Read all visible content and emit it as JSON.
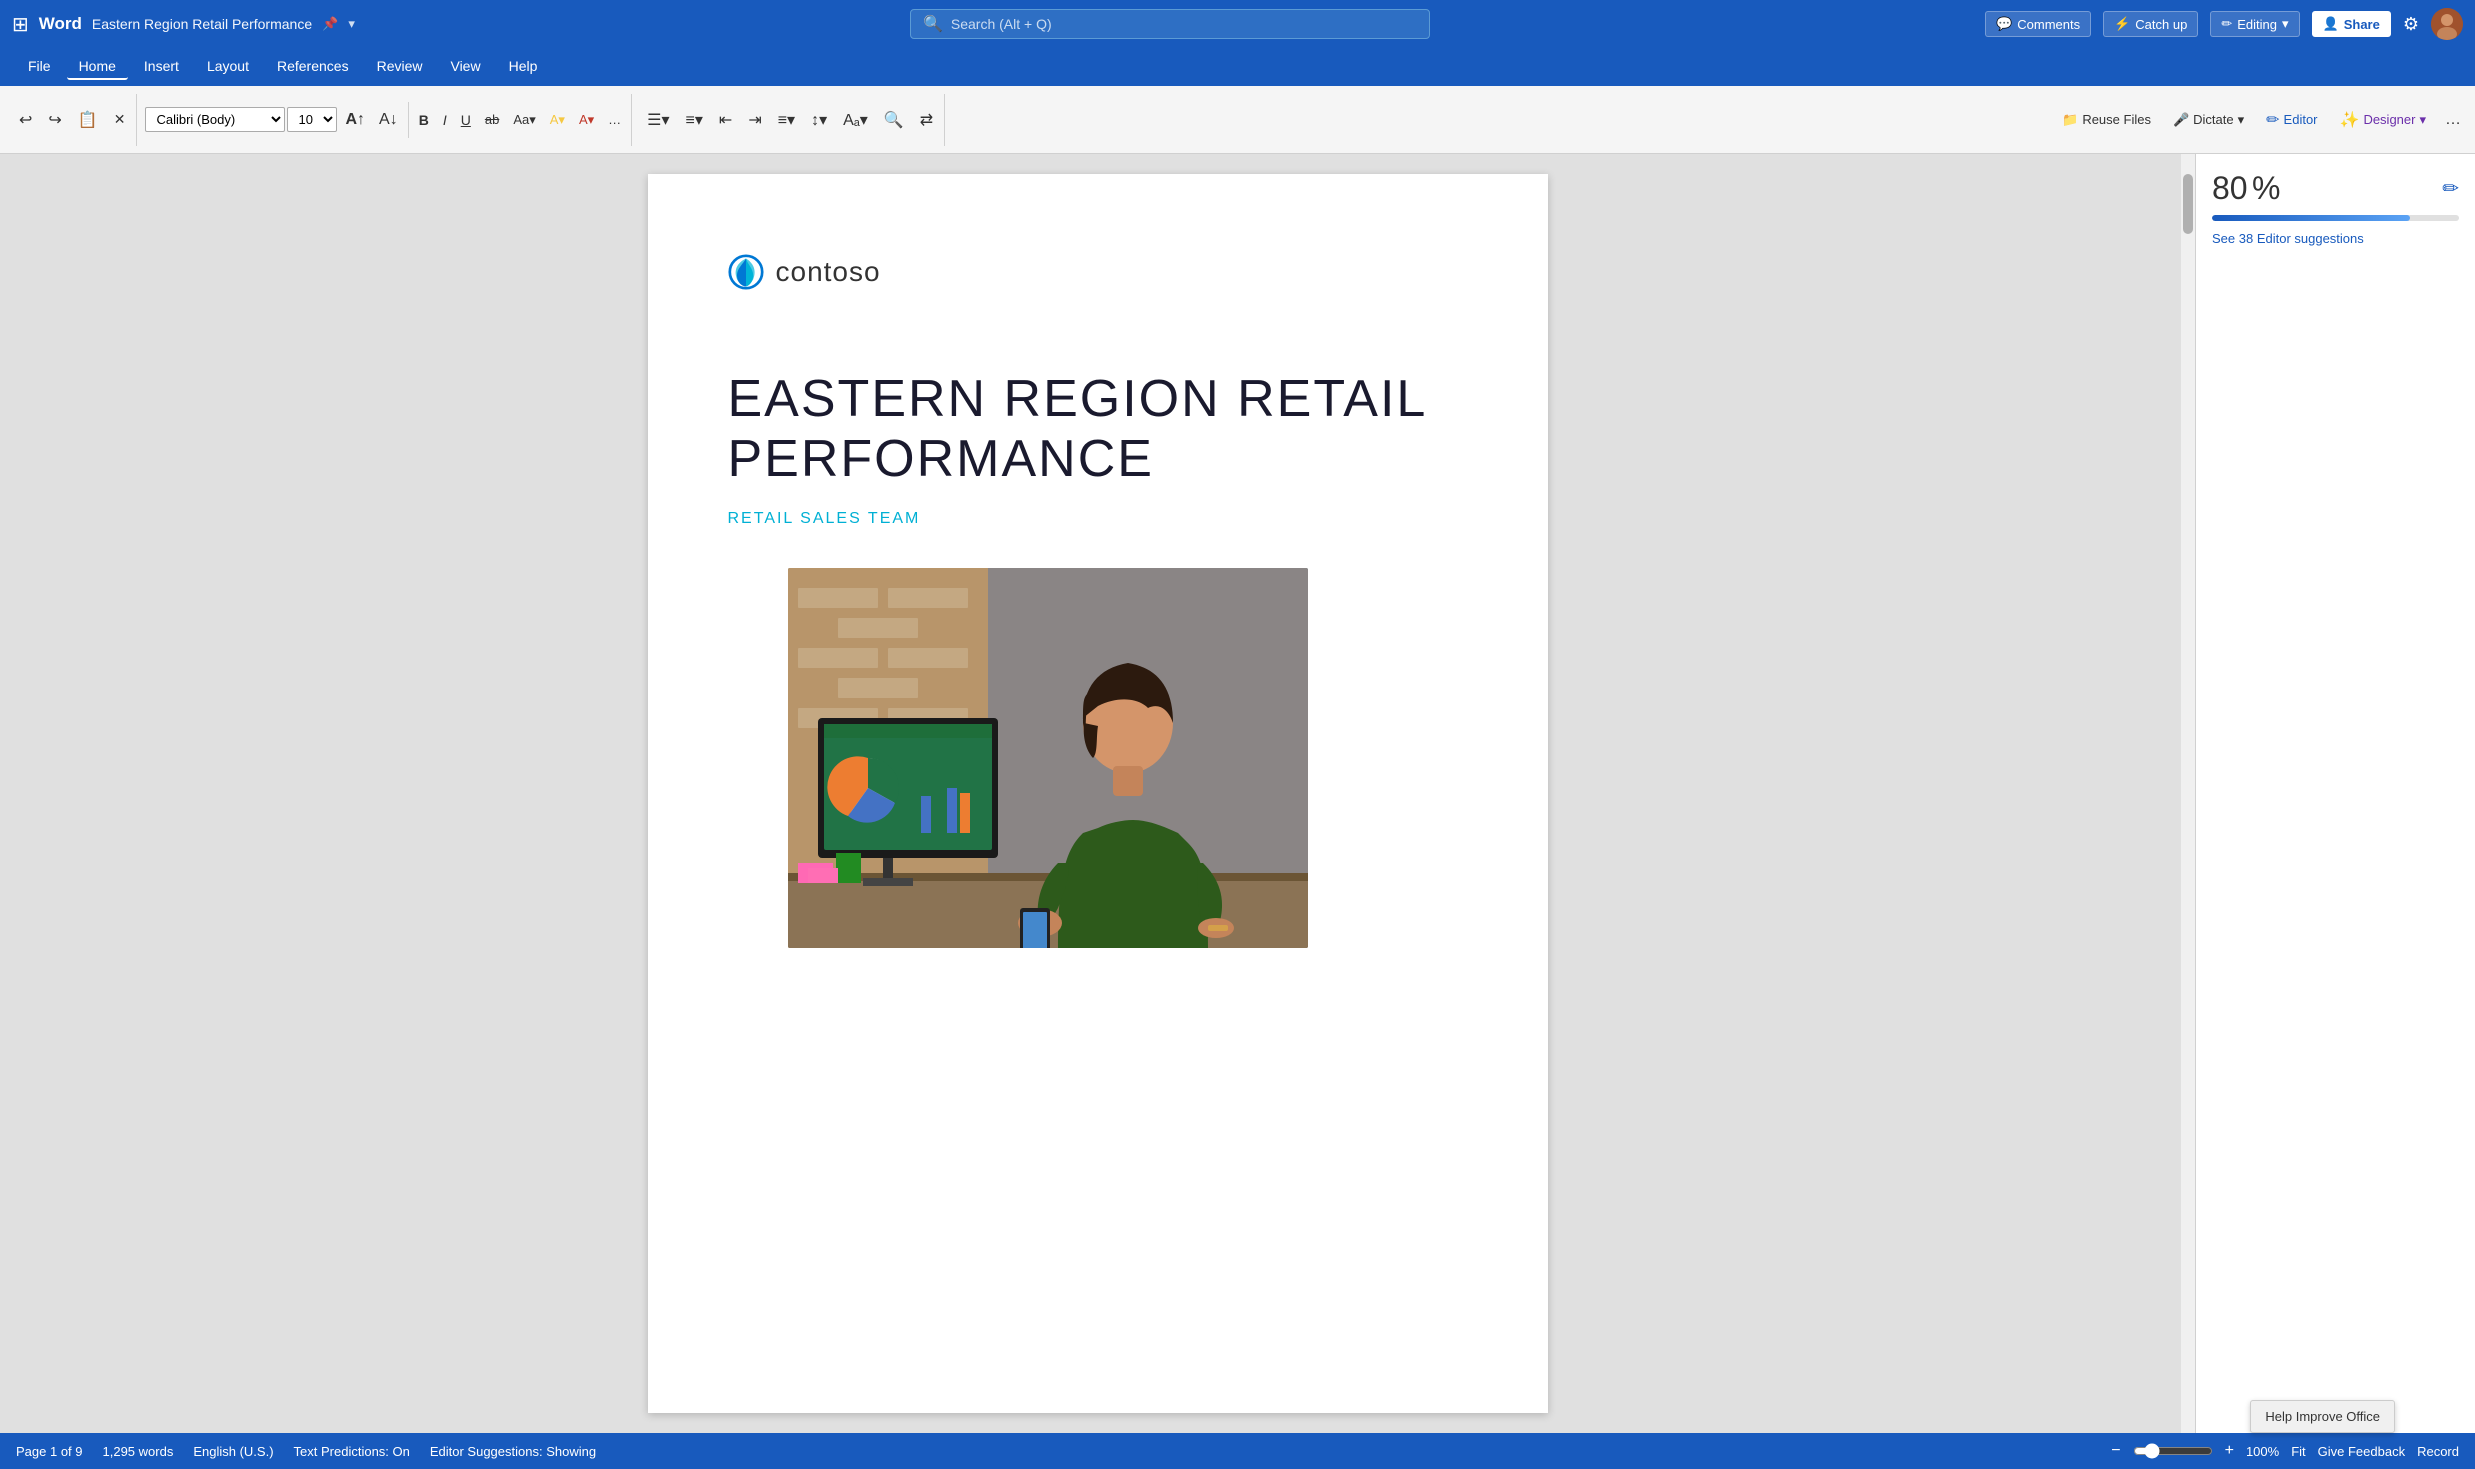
{
  "titlebar": {
    "app_name": "Word",
    "doc_title": "Eastern Region Retail Performance",
    "pin_icon": "📌",
    "dropdown_icon": "▾",
    "search_placeholder": "Search (Alt + Q)",
    "settings_icon": "⚙",
    "catch_up_label": "Catch up",
    "editing_label": "Editing",
    "share_label": "Share",
    "comments_label": "Comments"
  },
  "menu": {
    "items": [
      {
        "label": "File",
        "active": false
      },
      {
        "label": "Home",
        "active": true
      },
      {
        "label": "Insert",
        "active": false
      },
      {
        "label": "Layout",
        "active": false
      },
      {
        "label": "References",
        "active": false
      },
      {
        "label": "Review",
        "active": false
      },
      {
        "label": "View",
        "active": false
      },
      {
        "label": "Help",
        "active": false
      }
    ]
  },
  "ribbon": {
    "font_name": "Calibri (Body)",
    "font_size": "10",
    "undo_icon": "↩",
    "redo_icon": "↪",
    "bold_label": "B",
    "italic_label": "I",
    "underline_label": "U",
    "strikethrough_label": "ab",
    "more_icon": "...",
    "reuse_files_label": "Reuse Files",
    "dictate_label": "Dictate",
    "editor_label": "Editor",
    "designer_label": "Designer",
    "more_tools_icon": "..."
  },
  "editor_panel": {
    "score": "80%",
    "score_value": 80,
    "suggestions_text": "See 38 Editor suggestions",
    "pencil_icon": "✏"
  },
  "document": {
    "company": "contoso",
    "title_line1": "EASTERN REGION RETAIL",
    "title_line2": "PERFORMANCE",
    "subtitle": "RETAIL SALES TEAM"
  },
  "statusbar": {
    "page_info": "Page 1 of 9",
    "word_count": "1,295 words",
    "language": "English (U.S.)",
    "text_predictions": "Text Predictions: On",
    "editor_suggestions": "Editor Suggestions: Showing",
    "zoom_minus": "−",
    "zoom_plus": "+",
    "zoom_level": "100%",
    "fit_label": "Fit",
    "give_feedback_label": "Give Feedback",
    "record_label": "Record"
  },
  "help_improve_popup": {
    "text": "Help Improve Office"
  }
}
